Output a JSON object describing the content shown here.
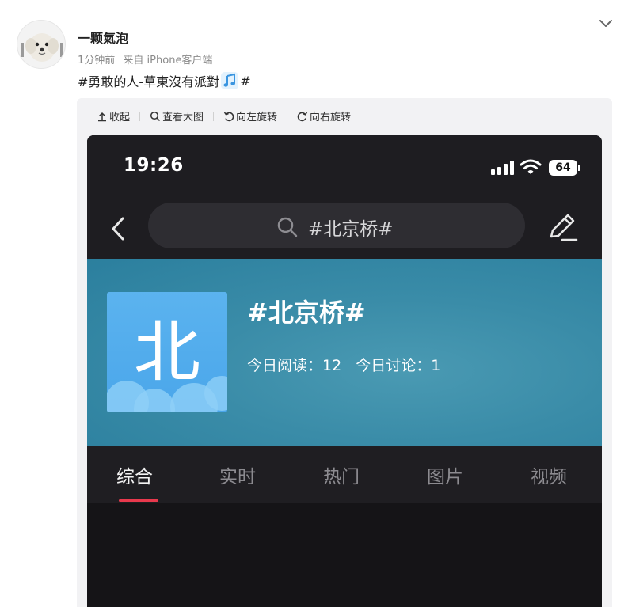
{
  "post": {
    "username": "一颗氣泡",
    "time_ago": "1分钟前",
    "source": "来自 iPhone客户端",
    "text_before": "#勇敢的人-草東沒有派對",
    "text_after": "#",
    "emoji_icon": "music-note-icon"
  },
  "toolbar": {
    "collapse": "收起",
    "view_large": "查看大图",
    "rotate_left": "向左旋转",
    "rotate_right": "向右旋转"
  },
  "phone": {
    "status": {
      "time": "19:26",
      "battery": "64"
    },
    "search": {
      "query": "#北京桥#"
    },
    "topic": {
      "icon_char": "北",
      "title": "#北京桥#",
      "read_today": "今日阅读：12",
      "discuss_today": "今日讨论：1"
    },
    "tabs": [
      {
        "label": "综合",
        "active": true
      },
      {
        "label": "实时",
        "active": false
      },
      {
        "label": "热门",
        "active": false
      },
      {
        "label": "图片",
        "active": false
      },
      {
        "label": "视频",
        "active": false
      }
    ]
  },
  "colors": {
    "accent_tab": "#e8394d",
    "banner": "#3a8ca8",
    "phone_bg": "#151417"
  }
}
